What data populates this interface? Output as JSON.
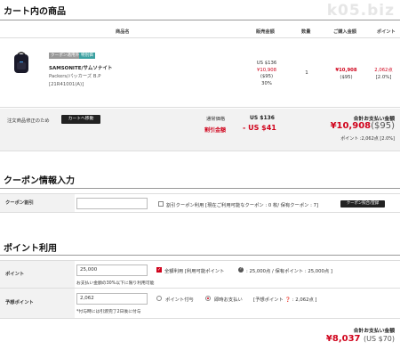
{
  "watermark": "k05.biz",
  "cart": {
    "title": "カート内の商品",
    "headers": {
      "product": "商品名",
      "sale_price": "販売金額",
      "qty": "数量",
      "purchase_amount": "ご購入金額",
      "points": "ポイント"
    },
    "item": {
      "tag_coupon": "クーポン適用外",
      "tag_sale": "特別価",
      "brand": "SAMSONITE/サムソナイト",
      "name": "Packers/パッカーズ B.P",
      "code": "[21R41001(A)]",
      "price_usd": "US $136",
      "price_yen": "¥10,908",
      "price_usd_sub": "($95)",
      "discount": "30%",
      "qty": "1",
      "buy_yen": "¥10,908",
      "buy_usd": "($95)",
      "points": "2,062点",
      "point_rate": "[2.0%]"
    },
    "summary": {
      "note": "注文商品修正のため",
      "cart_button": "カートへ移動",
      "normal_label": "通常価格",
      "normal_value": "US $136",
      "discount_label": "割引金額",
      "discount_value": "- US $41",
      "total_label": "合計お支払い金額",
      "total_yen": "¥10,908",
      "total_usd": "($95)",
      "total_points": "ポイント :2,062点 [2.0%]"
    }
  },
  "coupon": {
    "title": "クーポン情報入力",
    "label": "クーポン割引",
    "input_value": "",
    "checkbox_text": "割引クーポン利用 [現在ご利用可能なクーポン : 0 枚/ 保有クーポン : 7]",
    "button": "クーポン照合/登録"
  },
  "points": {
    "title": "ポイント利用",
    "point_label": "ポイント",
    "point_value": "25,000",
    "use_all_text": "全額利用 [利用可能ポイント",
    "use_all_rest": ": 25,000点 / 保有ポイント : 25,000点 ]",
    "point_warning": "お支払い金額の30%以下に限り利用可能",
    "planned_label": "予想ポイント",
    "planned_value": "2,062",
    "radio_grant": "ポイント付与",
    "radio_instant": "即時お支払い",
    "planned_text": "[予想ポイント ❓ : 2,062点 ]",
    "planned_note": "*付与時には引渡完了2日後に付与",
    "total_label": "合計お支払い金額",
    "total_yen": "¥8,037",
    "total_usd": "(US $70)"
  }
}
